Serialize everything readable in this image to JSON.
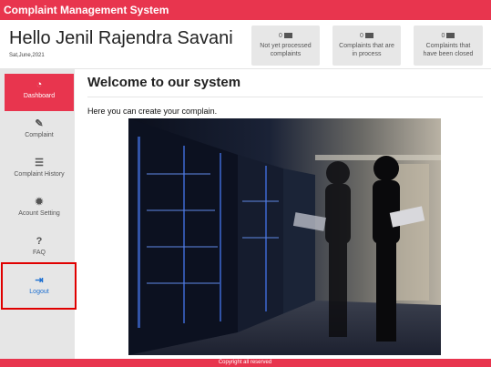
{
  "app": {
    "title": "Complaint Management System"
  },
  "header": {
    "greeting": "Hello Jenil Rajendra Savani",
    "date": "Sat,June,2021"
  },
  "stats": [
    {
      "count": "0",
      "label_line1": "Not yet processed",
      "label_line2": "complaints",
      "icon": "database-icon"
    },
    {
      "count": "0",
      "label_line1": "Complaints that are",
      "label_line2": "in process",
      "icon": "database-icon"
    },
    {
      "count": "0",
      "label_line1": "Complaints that",
      "label_line2": "have been closed",
      "icon": "database-icon"
    }
  ],
  "sidebar": {
    "items": [
      {
        "label": "Dashboard",
        "icon": "dashboard-icon",
        "glyph": "◔"
      },
      {
        "label": "Complaint",
        "icon": "pencil-icon",
        "glyph": "✎"
      },
      {
        "label": "Complaint History",
        "icon": "list-icon",
        "glyph": "☰"
      },
      {
        "label": "Acount Setting",
        "icon": "gear-icon",
        "glyph": "✹"
      },
      {
        "label": "FAQ",
        "icon": "question-icon",
        "glyph": "?"
      },
      {
        "label": "Logout",
        "icon": "logout-icon",
        "glyph": "⇥"
      }
    ]
  },
  "main": {
    "heading": "Welcome to our system",
    "intro": "Here you can create your complain."
  },
  "footer": {
    "text": "Copyright all reserved"
  },
  "colors": {
    "accent": "#e8354e",
    "sidebar_bg": "#e6e6e6",
    "link": "#1c6fd1",
    "annotation": "#e00000"
  }
}
